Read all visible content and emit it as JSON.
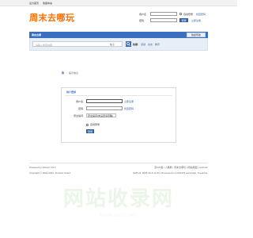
{
  "topbar": {
    "links": [
      "设为首页",
      "收藏本站"
    ]
  },
  "site": {
    "logo_text": "周末去哪玩"
  },
  "header_login": {
    "username_label": "用户名",
    "password_label": "密码",
    "auto_login_label": "自动登录",
    "find_password_link": "找回密码",
    "login_button": "登录",
    "register_link": "立即注册"
  },
  "navbar": {
    "title": "周末去哪",
    "quick_nav": "快捷导航"
  },
  "search": {
    "placeholder": "请输入搜索内容",
    "scope": "帖子",
    "hot_label": "热搜:",
    "hot_items": [
      "活动",
      "交友",
      "教育"
    ]
  },
  "breadcrumb": {
    "home_icon": "home-icon",
    "separator": "›",
    "current": "提示信息"
  },
  "login_panel": {
    "title": "用户登录",
    "username_label": "用户名:",
    "register_link": "立即注册",
    "password_label": "密码:",
    "find_password_link": "找回密码",
    "security_question_label": "安全提问:",
    "security_question_value": "安全提问(未设置请忽略)",
    "auto_login_label": "自动登录",
    "login_button": "登录"
  },
  "footer": {
    "left_line1": "Powered by Discuz! X3.4",
    "left_line2": "Copyright © 2001-2021, Tencent Cloud.",
    "right_line1": "京ICP备 | 小黑屋 | 周末去哪玩 | 网站地图 | Archiver",
    "right_line2": "GMT+8, 2025-10-5 12:23, Processed in 0.034476 second(s), 5 queries."
  },
  "watermark": {
    "big": "网站收录网",
    "small": "www.wzsl.net"
  },
  "colors": {
    "brand_orange": "#ff6e00",
    "nav_blue": "#3a6fbf",
    "link_blue": "#336699"
  }
}
